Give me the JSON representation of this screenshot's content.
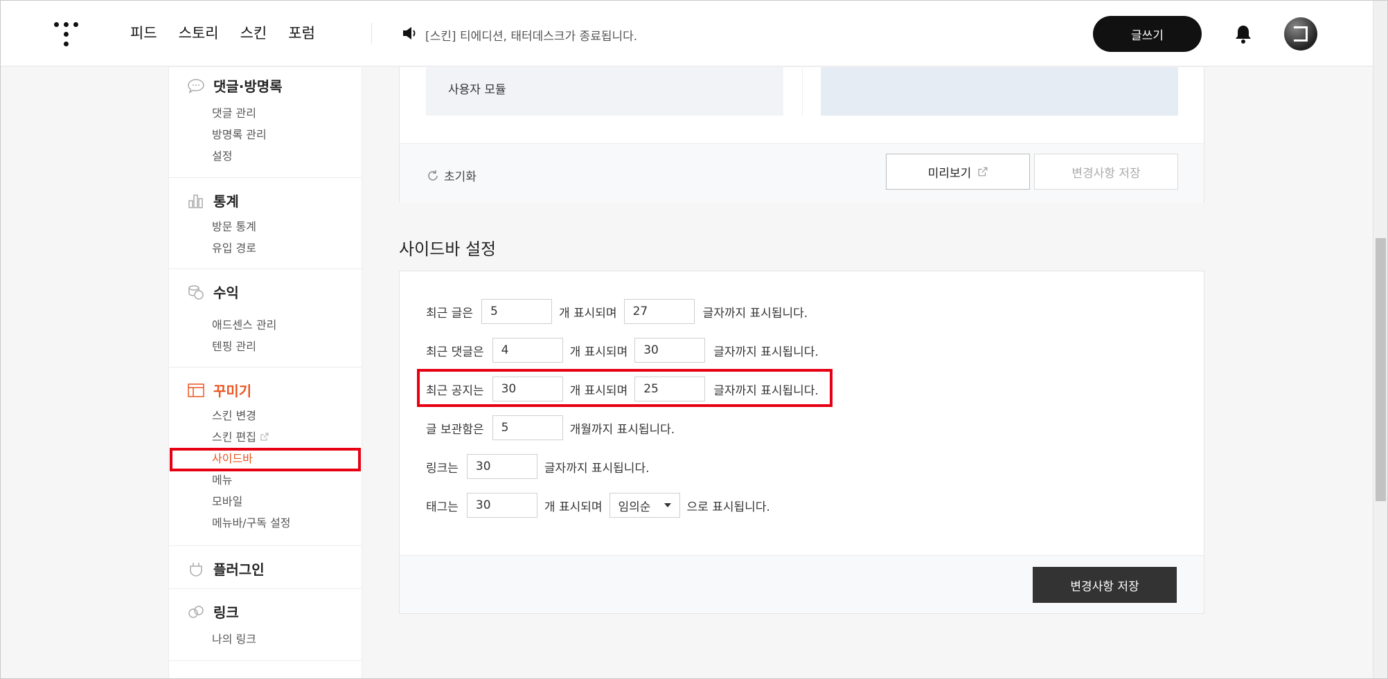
{
  "header": {
    "nav": [
      "피드",
      "스토리",
      "스킨",
      "포럼"
    ],
    "notice": "[스킨] 티에디션, 태터데스크가 종료됩니다.",
    "write_button": "글쓰기"
  },
  "sidebar": {
    "comments": {
      "title": "댓글·방명록",
      "items": [
        "댓글 관리",
        "방명록 관리",
        "설정"
      ]
    },
    "stats": {
      "title": "통계",
      "items": [
        "방문 통계",
        "유입 경로"
      ]
    },
    "revenue": {
      "title": "수익",
      "items": [
        "애드센스 관리",
        "텐핑 관리"
      ]
    },
    "decorate": {
      "title": "꾸미기",
      "items": [
        "스킨 변경",
        "스킨 편집",
        "사이드바",
        "메뉴",
        "모바일",
        "메뉴바/구독 설정"
      ]
    },
    "plugin": {
      "title": "플러그인"
    },
    "link": {
      "title": "링크",
      "items": [
        "나의 링크"
      ]
    }
  },
  "module_area": {
    "user_module": "사용자 모듈",
    "reset": "초기화",
    "preview": "미리보기",
    "save_disabled": "변경사항 저장"
  },
  "sidebar_settings": {
    "title": "사이드바 설정",
    "recent_posts": {
      "label": "최근 글은",
      "count": "5",
      "mid": "개 표시되며",
      "chars": "27",
      "suffix": "글자까지 표시됩니다."
    },
    "recent_comments": {
      "label": "최근 댓글은",
      "count": "4",
      "mid": "개 표시되며",
      "chars": "30",
      "suffix": "글자까지 표시됩니다."
    },
    "recent_notices": {
      "label": "최근 공지는",
      "count": "30",
      "mid": "개 표시되며",
      "chars": "25",
      "suffix": "글자까지 표시됩니다."
    },
    "archive": {
      "label": "글 보관함은",
      "count": "5",
      "suffix": "개월까지 표시됩니다."
    },
    "links": {
      "label": "링크는",
      "chars": "30",
      "suffix": "글자까지 표시됩니다."
    },
    "tags": {
      "label": "태그는",
      "count": "30",
      "mid": "개 표시되며",
      "order": "임의순",
      "suffix": "으로 표시됩니다."
    },
    "save": "변경사항 저장"
  }
}
